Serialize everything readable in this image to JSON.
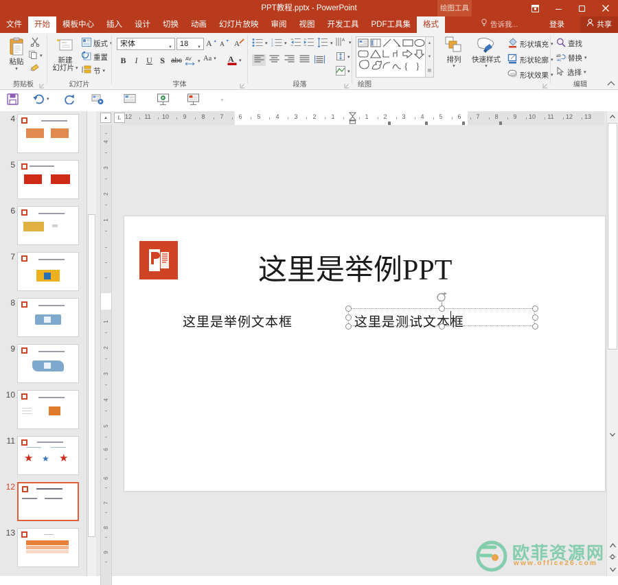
{
  "window": {
    "title": "PPT教程.pptx - PowerPoint",
    "contextual_tab_group": "绘图工具",
    "restore_label": "⛶",
    "minimize_label": "—",
    "maximize_label": "▢",
    "close_label": "✕",
    "accent_color": "#b83b1d",
    "share_bg": "#a83318"
  },
  "tabs": [
    {
      "label": "文件",
      "state": "file"
    },
    {
      "label": "开始",
      "state": "active"
    },
    {
      "label": "模板中心",
      "state": "normal"
    },
    {
      "label": "插入",
      "state": "normal"
    },
    {
      "label": "设计",
      "state": "normal"
    },
    {
      "label": "切换",
      "state": "normal"
    },
    {
      "label": "动画",
      "state": "normal"
    },
    {
      "label": "幻灯片放映",
      "state": "normal"
    },
    {
      "label": "审阅",
      "state": "normal"
    },
    {
      "label": "视图",
      "state": "normal"
    },
    {
      "label": "开发工具",
      "state": "normal"
    },
    {
      "label": "PDF工具集",
      "state": "normal"
    },
    {
      "label": "格式",
      "state": "ctxactive"
    }
  ],
  "tellme": {
    "label": "告诉我...",
    "icon": "lightbulb-icon"
  },
  "account": {
    "signin": "登录",
    "share": "共享",
    "share_icon": "person-icon"
  },
  "ribbon": {
    "groups": [
      {
        "name": "剪贴板"
      },
      {
        "name": "幻灯片"
      },
      {
        "name": "字体"
      },
      {
        "name": "段落"
      },
      {
        "name": "绘图"
      },
      {
        "name": "编辑"
      }
    ],
    "clipboard": {
      "paste": "粘贴",
      "cut_icon": "scissors-icon",
      "copy_icon": "copy-icon",
      "format_painter_icon": "format-painter-icon"
    },
    "slides": {
      "new_slide_line1": "新建",
      "new_slide_line2": "幻灯片",
      "layout": "版式",
      "reset": "重置",
      "section": "节"
    },
    "font": {
      "family_value": "宋体",
      "size_value": "18",
      "grow_icon": "grow-font-icon",
      "shrink_icon": "shrink-font-icon",
      "clear_format_icon": "clear-formatting-icon",
      "bold": "B",
      "italic": "I",
      "underline": "U",
      "shadow": "S",
      "strikethrough": "abc",
      "char_spacing_icon": "character-spacing-icon",
      "change_case": "Aa",
      "font_color": "A"
    },
    "paragraph": {
      "bullets_icon": "bullet-list-icon",
      "numbering_icon": "numbered-list-icon",
      "decrease_indent_icon": "decrease-indent-icon",
      "increase_indent_icon": "increase-indent-icon",
      "line_spacing_icon": "line-spacing-icon",
      "text_direction_icon": "text-direction-icon",
      "align_text_icon": "align-text-icon",
      "align_left_icon": "align-left-icon",
      "align_center_icon": "align-center-icon",
      "align_right_icon": "align-right-icon",
      "justify_icon": "justify-icon",
      "distribute_icon": "distribute-icon",
      "columns_icon": "columns-icon",
      "smartart_icon": "smartart-icon"
    },
    "drawing": {
      "arrange": "排列",
      "quick_styles": "快速样式",
      "shape_fill": "形状填充",
      "shape_outline": "形状轮廓",
      "shape_effects": "形状效果"
    },
    "editing": {
      "find": "查找",
      "replace": "替换",
      "select": "选择",
      "find_icon": "magnifier-icon",
      "replace_icon": "replace-icon",
      "select_icon": "cursor-icon"
    },
    "collapse_icon": "chevron-up-icon"
  },
  "qat": {
    "buttons": [
      {
        "name": "save-button",
        "icon": "save-icon"
      },
      {
        "name": "undo-button",
        "icon": "undo-icon"
      },
      {
        "name": "redo-button",
        "icon": "redo-icon"
      },
      {
        "name": "start-from-beginning-button",
        "icon": "present-icon"
      },
      {
        "name": "new-slide-quick-button",
        "icon": "new-slide-icon"
      },
      {
        "name": "slideshow-button",
        "icon": "slideshow-icon"
      },
      {
        "name": "slideshow-current-button",
        "icon": "slideshow-current-icon"
      },
      {
        "name": "customize-qat-button",
        "icon": "chevron-down-icon"
      }
    ]
  },
  "ruler": {
    "horizontal_left": [
      "12",
      "11",
      "10",
      "9",
      "8",
      "7",
      "6",
      "5",
      "4",
      "3",
      "2",
      "1"
    ],
    "horizontal_right": [
      "1",
      "2",
      "3",
      "4",
      "5",
      "6",
      "7",
      "8",
      "9",
      "10",
      "11",
      "12",
      "13"
    ],
    "vertical_top": [
      "4",
      "3",
      "2",
      "1"
    ],
    "vertical_bottom": [
      "1",
      "2",
      "3",
      "4",
      "5",
      "6",
      "7",
      "8",
      "9"
    ]
  },
  "thumbnails": {
    "selected_index": 12,
    "items": [
      {
        "number": "4",
        "title": "这里是举例PPT"
      },
      {
        "number": "5",
        "title": "这里是举例PPT"
      },
      {
        "number": "6",
        "title": "这里是举例PPT"
      },
      {
        "number": "7",
        "title": "这里是举例PPT"
      },
      {
        "number": "8",
        "title": "这里是举例PPT"
      },
      {
        "number": "9",
        "title": "这里是举例PPT"
      },
      {
        "number": "10",
        "title": "这里是举例PPT"
      },
      {
        "number": "11",
        "title": "这里是举例PPT"
      },
      {
        "number": "12",
        "title": "这里是举例PPT"
      },
      {
        "number": "13",
        "title": ""
      }
    ]
  },
  "slide": {
    "title": "这里是举例PPT",
    "textbox_left": "这里是举例文本框",
    "textbox_selected": "这里是测试文本框",
    "logo_letter": "P",
    "logo_color": "#d04423",
    "selection": {
      "rotate_icon": "rotate-handle-icon",
      "handle_icon": "resize-handle-icon"
    }
  },
  "watermark": {
    "text": "欧菲资源网",
    "url": "www.office26.com",
    "logo_letter": "F",
    "green": "#86cdb0",
    "orange": "#e9a44c"
  }
}
